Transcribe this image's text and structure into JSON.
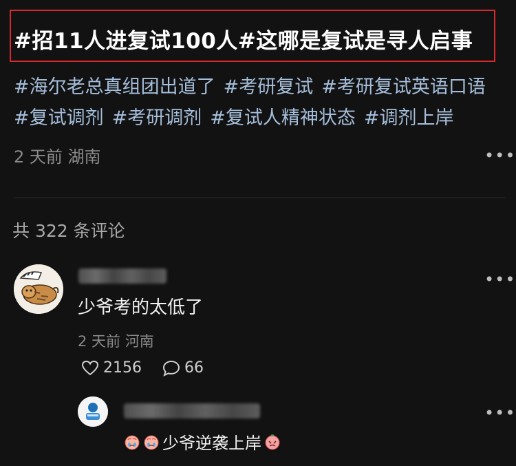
{
  "post": {
    "title": "#招11人进复试100人#这哪是复试是寻人启事",
    "tags": [
      "#海尔老总真组团出道了",
      "#考研复试",
      "#考研复试英语口语",
      "#复试调剂",
      "#考研调剂",
      "#复试人精神状态",
      "#调剂上岸"
    ],
    "meta": "2 天前 湖南",
    "more_icon": "ellipsis-icon"
  },
  "comments_header": "共 322 条评论",
  "comment": {
    "text": "少爷考的太低了",
    "meta": "2 天前 河南",
    "likes": "2156",
    "replies": "66"
  },
  "reply": {
    "text": "少爷逆袭上岸"
  },
  "colors": {
    "background": "#121212",
    "highlight_border": "#d8292f",
    "tag": "#a5bedb",
    "muted": "#8a8a8a"
  }
}
